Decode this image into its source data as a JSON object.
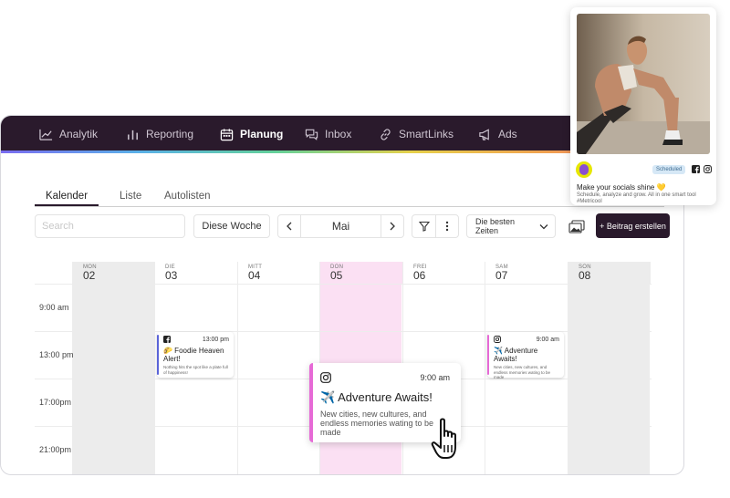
{
  "nav": {
    "items": [
      {
        "label": "Analytik",
        "icon": "chart-line-icon"
      },
      {
        "label": "Reporting",
        "icon": "bar-chart-icon"
      },
      {
        "label": "Planung",
        "icon": "calendar-icon"
      },
      {
        "label": "Inbox",
        "icon": "chat-icon"
      },
      {
        "label": "SmartLinks",
        "icon": "link-icon"
      },
      {
        "label": "Ads",
        "icon": "megaphone-icon"
      }
    ],
    "active": "Planung",
    "bg_color": "#2a1a2c"
  },
  "tabs": [
    {
      "label": "Kalender",
      "active": true
    },
    {
      "label": "Liste",
      "active": false
    },
    {
      "label": "Autolisten",
      "active": false
    }
  ],
  "toolbar": {
    "search_placeholder": "Search",
    "week_button": "Diese Woche",
    "month": "Mai",
    "best_times": "Die besten Zeiten",
    "create_button": "+ Beitrag erstellen"
  },
  "calendar": {
    "days": [
      {
        "abbr": "MON",
        "num": "02"
      },
      {
        "abbr": "DIE",
        "num": "03"
      },
      {
        "abbr": "MITT",
        "num": "04"
      },
      {
        "abbr": "DON",
        "num": "05"
      },
      {
        "abbr": "FREI",
        "num": "06"
      },
      {
        "abbr": "SAM",
        "num": "07"
      },
      {
        "abbr": "SON",
        "num": "08"
      }
    ],
    "highlight_color": "#fbe0f3",
    "times": [
      "9:00 am",
      "13:00 pm",
      "17:00pm",
      "21:00pm"
    ]
  },
  "posts": {
    "foodie": {
      "network": "facebook",
      "time": "13:00 pm",
      "title": "🌮 Foodie Heaven Alert!",
      "body": "Nothing hits the spot like a plate full of happiness!",
      "color": "#5a63d8"
    },
    "adventure_small": {
      "network": "instagram",
      "time": "9:00 am",
      "title": "✈️ Adventure Awaits!",
      "body": "New cities, new cultures, and endless memories wating to be made",
      "color": "#e66ad6"
    },
    "adventure_big": {
      "network": "instagram",
      "time": "9:00 am",
      "title": "✈️ Adventure Awaits!",
      "body": "New cities, new cultures, and endless memories wating to be made",
      "color": "#e66ad6"
    }
  },
  "social_card": {
    "status": "Scheduled",
    "title": "Make your socials shine 💛",
    "body": "Schedule, analyze and grow. All in one smart tool #Metricool",
    "networks": [
      "facebook-icon",
      "instagram-icon"
    ]
  }
}
